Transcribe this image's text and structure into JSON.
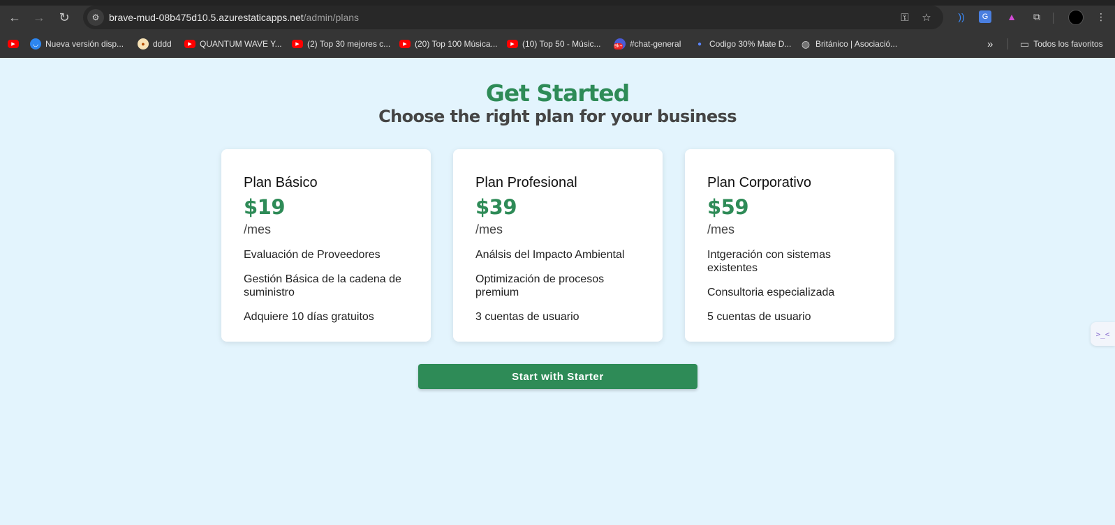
{
  "browser": {
    "url_host": "brave-mud-08b475d10.5.azurestaticapps.net",
    "url_path": "/admin/plans",
    "bookmarks": [
      {
        "label": "",
        "icon": "youtube-icon"
      },
      {
        "label": "Nueva versión disp...",
        "icon": "shield-icon"
      },
      {
        "label": "dddd",
        "icon": "egg-icon"
      },
      {
        "label": "QUANTUM WAVE Y...",
        "icon": "youtube-icon"
      },
      {
        "label": "(2) Top 30 mejores c...",
        "icon": "youtube-icon"
      },
      {
        "label": "(20) Top 100 Música...",
        "icon": "youtube-icon"
      },
      {
        "label": "(10) Top 50 - Músic...",
        "icon": "youtube-icon"
      },
      {
        "label": "#chat-general",
        "icon": "chat-icon",
        "badge": "9k+"
      },
      {
        "label": "Codigo 30% Mate D...",
        "icon": "dot-icon"
      },
      {
        "label": "Británico | Asociació...",
        "icon": "globe-icon"
      }
    ],
    "all_bookmarks_label": "Todos los favoritos",
    "overflow_label": "»"
  },
  "page": {
    "title": "Get Started",
    "subtitle": "Choose the right plan for your business",
    "accent_color": "#2e8b57",
    "background_color": "#e3f4fd"
  },
  "plans": [
    {
      "name": "Plan Básico",
      "price": "$19",
      "period": "/mes",
      "features": [
        "Evaluación de Proveedores",
        "Gestión Básica de la cadena de suministro",
        "Adquiere 10 días gratuitos"
      ]
    },
    {
      "name": "Plan Profesional",
      "price": "$39",
      "period": "/mes",
      "features": [
        "Análsis del Impacto Ambiental",
        "Optimización de procesos premium",
        "3 cuentas de usuario"
      ]
    },
    {
      "name": "Plan Corporativo",
      "price": "$59",
      "period": "/mes",
      "features": [
        "Intgeración con sistemas existentes",
        "Consultoria especializada",
        "5 cuentas de usuario"
      ]
    }
  ],
  "cta": {
    "label": "Start with Starter"
  },
  "side_tab": {
    "label": ">_<"
  }
}
